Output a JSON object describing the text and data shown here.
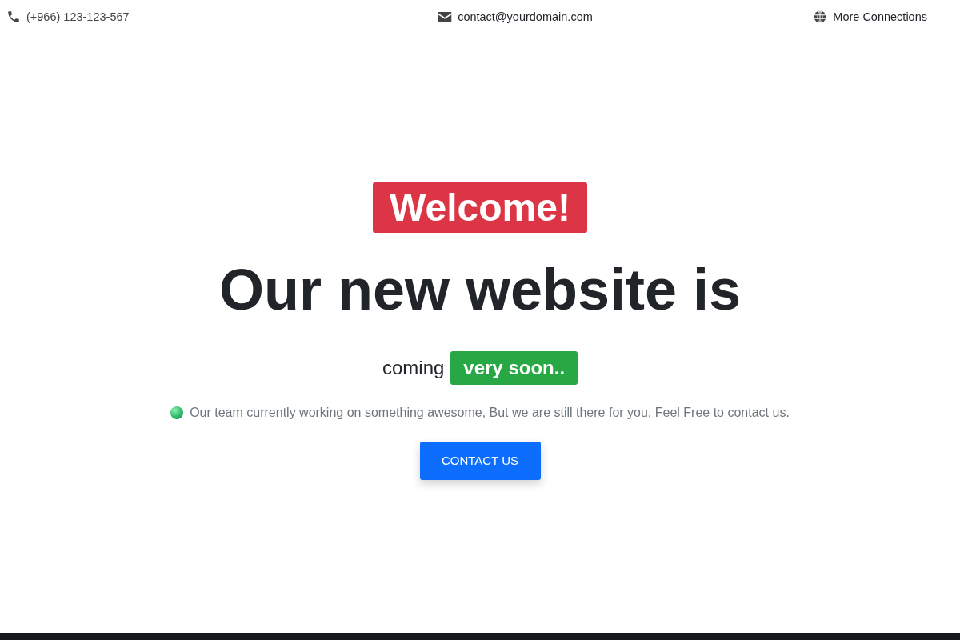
{
  "top_bar": {
    "phone": "(+966) 123-123-567",
    "email": "contact@yourdomain.com",
    "connections": "More Connections"
  },
  "hero": {
    "badge": "Welcome!",
    "heading": "Our new website is",
    "subheading": "coming",
    "subheading_badge": "very soon..",
    "message": "Our team currently working on something awesome, But we are still there for you, Feel Free to contact us.",
    "button": "CONTACT US"
  }
}
